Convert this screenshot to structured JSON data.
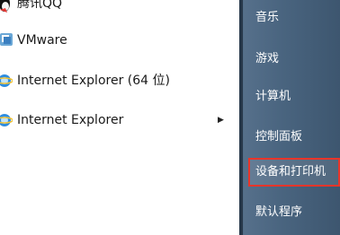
{
  "programs": [
    {
      "label": "腾讯QQ",
      "icon": "qq-penguin-icon"
    },
    {
      "label": "VMware",
      "icon": "vmware-icon"
    },
    {
      "label": "Internet Explorer (64 位)",
      "icon": "internet-explorer-icon"
    },
    {
      "label": "Internet Explorer",
      "icon": "internet-explorer-icon",
      "submenu_arrow": "▶"
    }
  ],
  "right_menu": [
    {
      "label": "音乐"
    },
    {
      "label": "游戏"
    },
    {
      "label": "计算机"
    },
    {
      "label": "控制面板"
    },
    {
      "label": "设备和打印机",
      "selected": true
    },
    {
      "label": "默认程序"
    }
  ],
  "colors": {
    "highlight_border": "#e8352a",
    "right_pane": "#4a6580"
  }
}
